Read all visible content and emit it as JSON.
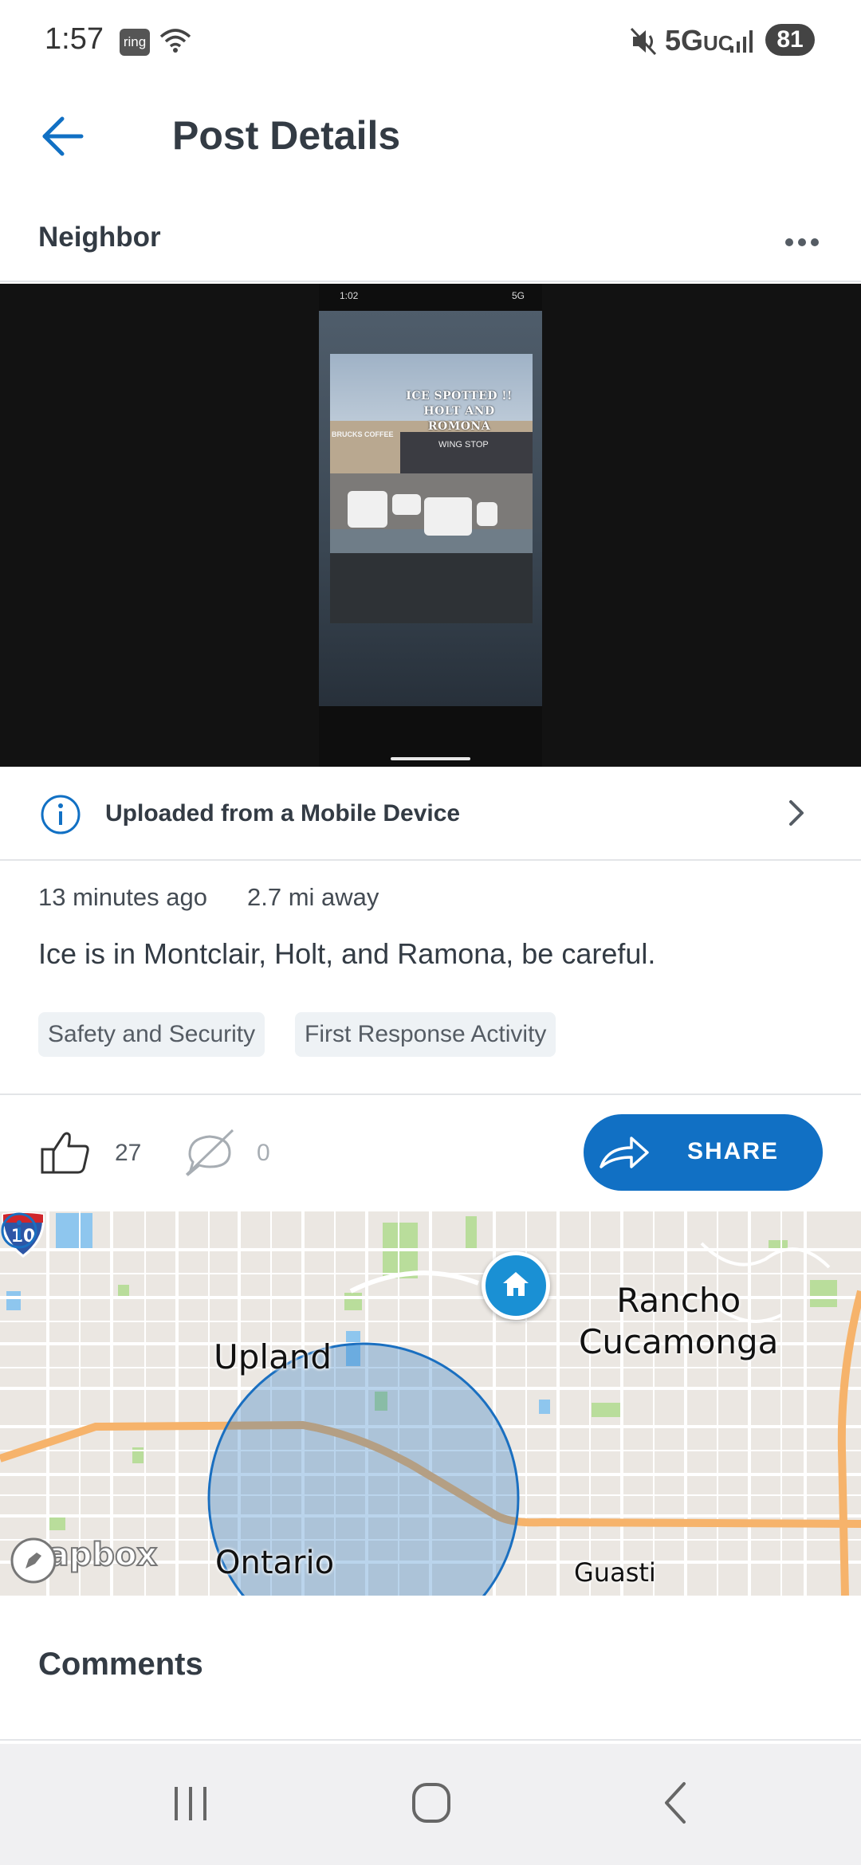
{
  "status_bar": {
    "time": "1:57",
    "app_badge": "ring",
    "network": "5G",
    "network_suffix": "UC",
    "battery": "81"
  },
  "header": {
    "title": "Post Details"
  },
  "post": {
    "author": "Neighbor",
    "media": {
      "phone_time": "1:02",
      "phone_network": "5G",
      "overlay_text_line1": "ICE SPOTTED !!",
      "overlay_text_line2": "HOLT AND ROMONA",
      "store_sign": "WING STOP",
      "left_sign": "BRUCKS COFFEE"
    },
    "upload_source": "Uploaded from a Mobile Device",
    "time_ago": "13 minutes ago",
    "distance": "2.7 mi away",
    "body": "Ice is in Montclair, Holt, and Ramona, be careful.",
    "tags": [
      "Safety and Security",
      "First Response Activity"
    ],
    "likes": "27",
    "comments": "0",
    "share_label": "SHARE"
  },
  "map": {
    "labels": {
      "upland": "Upland",
      "rancho_line1": "Rancho",
      "rancho_line2": "Cucamonga",
      "ontario": "Ontario",
      "guasti": "Guasti"
    },
    "interstate": "10",
    "logo": "mapbox"
  },
  "comments_title": "Comments",
  "colors": {
    "accent": "#1170c4",
    "text": "#333b44",
    "map_circle": "#1a6fc0"
  }
}
